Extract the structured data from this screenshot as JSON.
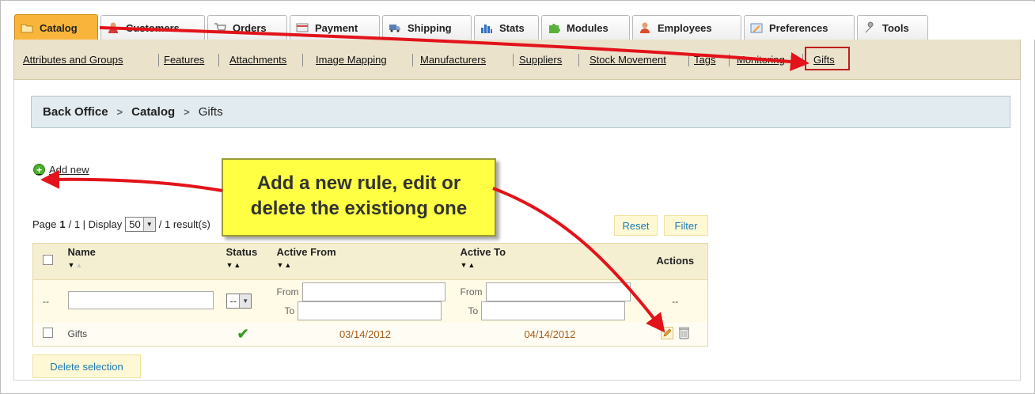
{
  "tabs": [
    {
      "label": "Catalog",
      "icon": "folder-icon",
      "active": true
    },
    {
      "label": "Customers",
      "icon": "customers-icon"
    },
    {
      "label": "Orders",
      "icon": "cart-icon"
    },
    {
      "label": "Payment",
      "icon": "payment-icon"
    },
    {
      "label": "Shipping",
      "icon": "truck-icon"
    },
    {
      "label": "Stats",
      "icon": "bar-chart-icon"
    },
    {
      "label": "Modules",
      "icon": "puzzle-icon"
    },
    {
      "label": "Employees",
      "icon": "employees-icon"
    },
    {
      "label": "Preferences",
      "icon": "preferences-icon"
    },
    {
      "label": "Tools",
      "icon": "wrench-icon"
    }
  ],
  "subnav": [
    "Attributes and Groups",
    "Features",
    "Attachments",
    "Image Mapping",
    "Manufacturers",
    "Suppliers",
    "Stock Movement",
    "Tags",
    "Monitoring",
    "Gifts"
  ],
  "breadcrumb": {
    "root": "Back Office",
    "section": "Catalog",
    "current": "Gifts"
  },
  "add_new": "Add new",
  "pager": {
    "page_prefix": "Page",
    "page": "1",
    "pages": "/ 1 | Display",
    "per_page": "50",
    "results": "/ 1 result(s)"
  },
  "buttons": {
    "reset": "Reset",
    "filter": "Filter",
    "delete_selection": "Delete selection"
  },
  "columns": {
    "name": "Name",
    "status": "Status",
    "active_from": "Active From",
    "active_to": "Active To",
    "actions": "Actions"
  },
  "filter": {
    "dash": "--",
    "status_value": "--",
    "from": "From",
    "to": "To",
    "actions_dash": "--"
  },
  "rows": [
    {
      "name": "Gifts",
      "status": "enabled",
      "active_from": "03/14/2012",
      "active_to": "04/14/2012"
    }
  ],
  "callout": {
    "line1": "Add a new rule, edit or",
    "line2": "delete the existiong one"
  },
  "colors": {
    "active_tab": "#f9b53b",
    "subnav_bg": "#ebe2cc",
    "annotation_red": "#e2131a",
    "callout_yellow": "#ffff44",
    "link_blue": "#1a7ab7"
  }
}
